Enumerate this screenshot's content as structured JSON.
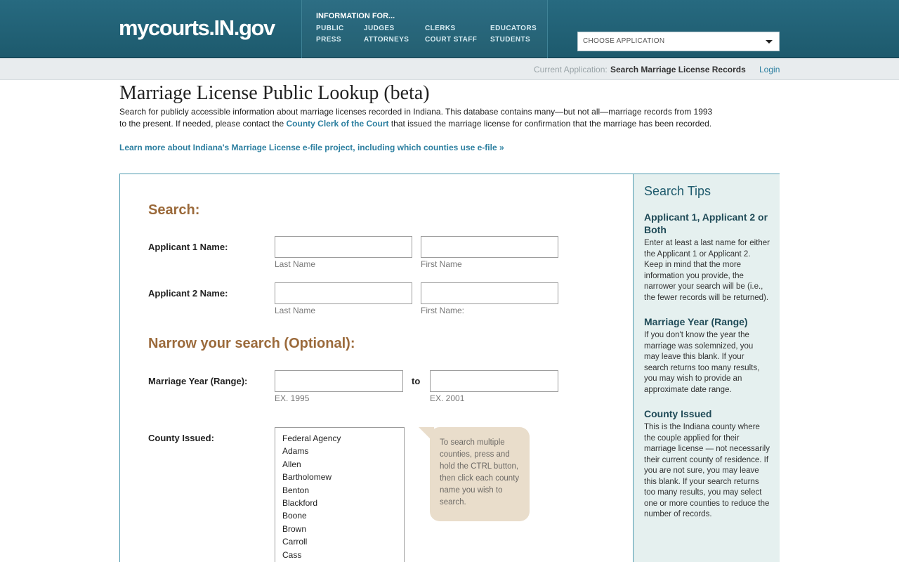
{
  "header": {
    "logo": "mycourts.IN.gov",
    "info_title": "INFORMATION FOR...",
    "links": {
      "public": "PUBLIC",
      "press": "PRESS",
      "judges": "JUDGES",
      "attorneys": "ATTORNEYS",
      "clerks": "CLERKS",
      "court_staff": "COURT STAFF",
      "educators": "EDUCATORS",
      "students": "STUDENTS"
    },
    "choose_app": "CHOOSE APPLICATION"
  },
  "subbar": {
    "current_label": "Current Application:",
    "current_value": "Search Marriage License Records",
    "login": "Login"
  },
  "page": {
    "title": "Marriage License Public Lookup (beta)",
    "intro_1": "Search for publicly accessible information about marriage licenses recorded in Indiana. This database contains many—but not all—marriage records from 1993 to the present. If needed, please contact the ",
    "intro_link": "County Clerk of the Court",
    "intro_2": " that issued the marriage license for confirmation that the marriage has been recorded.",
    "learn_more": "Learn more about Indiana's Marriage License e-file project, including which counties use e-file »"
  },
  "form": {
    "search_heading": "Search:",
    "applicant1_label": "Applicant 1 Name:",
    "applicant2_label": "Applicant 2 Name:",
    "last_name": "Last Name",
    "first_name": "First Name",
    "first_name_colon": "First Name:",
    "narrow_heading": "Narrow your search (Optional):",
    "year_label": "Marriage Year (Range):",
    "to": "to",
    "ex_from": "EX. 1995",
    "ex_to": "EX. 2001",
    "county_label": "County Issued:",
    "counties": [
      "Federal Agency",
      "Adams",
      "Allen",
      "Bartholomew",
      "Benton",
      "Blackford",
      "Boone",
      "Brown",
      "Carroll",
      "Cass"
    ],
    "tip": "To search multiple counties, press and hold the CTRL button, then click each county name you wish to search."
  },
  "sidebar": {
    "title": "Search Tips",
    "sections": [
      {
        "heading": "Applicant 1, Applicant 2 or Both",
        "text": "Enter at least a last name for either the Applicant 1 or Applicant 2. Keep in mind that the more information you provide, the narrower your search will be (i.e., the fewer records will be returned)."
      },
      {
        "heading": "Marriage Year (Range)",
        "text": "If you don't know the year the marriage was solemnized, you may leave this blank. If your search returns too many results, you may wish to provide an approximate date range."
      },
      {
        "heading": "County Issued",
        "text": "This is the Indiana county where the couple applied for their marriage license — not necessarily their current county of residence. If you are not sure, you may leave this blank. If your search returns too many results, you may select one or more counties to reduce the number of records."
      }
    ]
  }
}
